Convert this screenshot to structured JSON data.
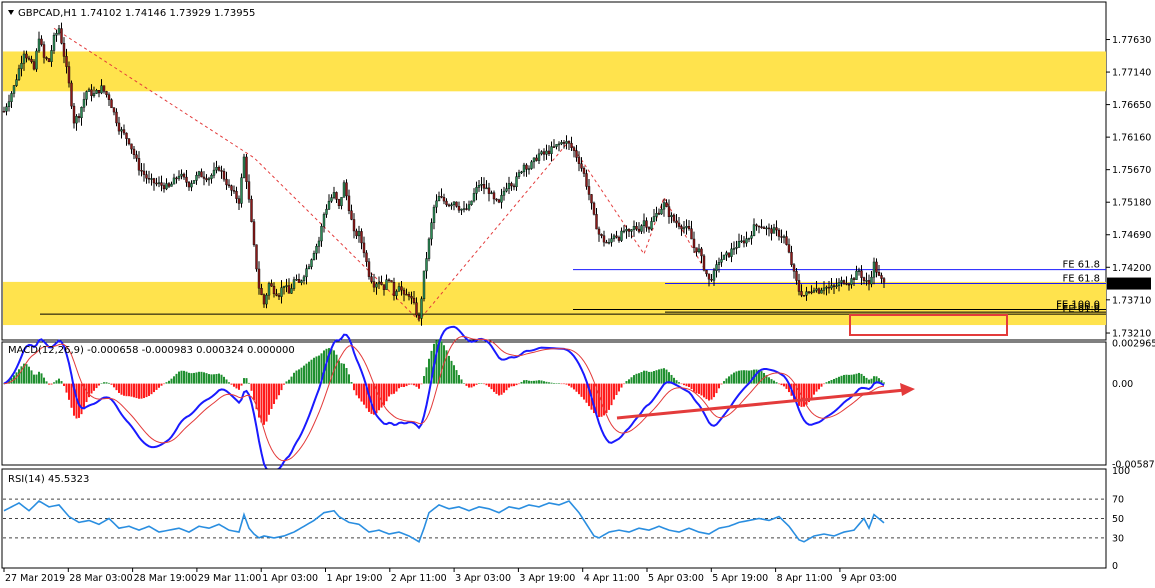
{
  "chart_data": {
    "type": "candlestick",
    "symbol_header": "GBPCAD,H1  1.74102 1.74146 1.73929 1.73955",
    "y_ticks": [
      "1.77630",
      "1.77140",
      "1.76650",
      "1.76160",
      "1.75670",
      "1.75180",
      "1.74690",
      "1.74200",
      "1.73710",
      "1.73210"
    ],
    "y_range": [
      1.7312,
      1.7818
    ],
    "current_price": "1.73955",
    "x_ticks": [
      "27 Mar 2019",
      "28 Mar 03:00",
      "28 Mar 19:00",
      "29 Mar 11:00",
      "1 Apr 03:00",
      "1 Apr 19:00",
      "2 Apr 11:00",
      "3 Apr 03:00",
      "3 Apr 19:00",
      "4 Apr 11:00",
      "5 Apr 03:00",
      "5 Apr 19:00",
      "8 Apr 11:00",
      "9 Apr 03:00"
    ],
    "price_path": [
      [
        0,
        1.7655
      ],
      [
        4,
        1.7692
      ],
      [
        8,
        1.7745
      ],
      [
        12,
        1.7718
      ],
      [
        14,
        1.7768
      ],
      [
        16,
        1.7735
      ],
      [
        18,
        1.773
      ],
      [
        20,
        1.7765
      ],
      [
        22,
        1.778
      ],
      [
        24,
        1.774
      ],
      [
        26,
        1.7695
      ],
      [
        28,
        1.764
      ],
      [
        30,
        1.765
      ],
      [
        33,
        1.7685
      ],
      [
        36,
        1.768
      ],
      [
        39,
        1.769
      ],
      [
        42,
        1.7675
      ],
      [
        46,
        1.763
      ],
      [
        50,
        1.761
      ],
      [
        54,
        1.757
      ],
      [
        58,
        1.755
      ],
      [
        62,
        1.7545
      ],
      [
        66,
        1.754
      ],
      [
        70,
        1.756
      ],
      [
        74,
        1.7545
      ],
      [
        78,
        1.756
      ],
      [
        82,
        1.7555
      ],
      [
        86,
        1.757
      ],
      [
        90,
        1.754
      ],
      [
        94,
        1.752
      ],
      [
        96,
        1.7585
      ],
      [
        98,
        1.752
      ],
      [
        100,
        1.745
      ],
      [
        102,
        1.739
      ],
      [
        104,
        1.7365
      ],
      [
        106,
        1.7395
      ],
      [
        108,
        1.7385
      ],
      [
        110,
        1.738
      ],
      [
        112,
        1.7395
      ],
      [
        114,
        1.738
      ],
      [
        116,
        1.74
      ],
      [
        118,
        1.7395
      ],
      [
        120,
        1.741
      ],
      [
        122,
        1.7425
      ],
      [
        124,
        1.7445
      ],
      [
        126,
        1.746
      ],
      [
        128,
        1.75
      ],
      [
        130,
        1.752
      ],
      [
        132,
        1.753
      ],
      [
        134,
        1.751
      ],
      [
        136,
        1.7545
      ],
      [
        138,
        1.751
      ],
      [
        140,
        1.747
      ],
      [
        142,
        1.747
      ],
      [
        144,
        1.7445
      ],
      [
        146,
        1.741
      ],
      [
        148,
        1.7395
      ],
      [
        150,
        1.74
      ],
      [
        152,
        1.739
      ],
      [
        154,
        1.7405
      ],
      [
        156,
        1.738
      ],
      [
        158,
        1.7395
      ],
      [
        160,
        1.7375
      ],
      [
        162,
        1.738
      ],
      [
        164,
        1.7362
      ],
      [
        166,
        1.734
      ],
      [
        168,
        1.741
      ],
      [
        170,
        1.746
      ],
      [
        172,
        1.751
      ],
      [
        174,
        1.7525
      ],
      [
        176,
        1.752
      ],
      [
        178,
        1.7515
      ],
      [
        180,
        1.752
      ],
      [
        182,
        1.751
      ],
      [
        184,
        1.7505
      ],
      [
        186,
        1.751
      ],
      [
        188,
        1.753
      ],
      [
        190,
        1.7545
      ],
      [
        192,
        1.754
      ],
      [
        194,
        1.7535
      ],
      [
        196,
        1.752
      ],
      [
        198,
        1.7515
      ],
      [
        200,
        1.7535
      ],
      [
        202,
        1.755
      ],
      [
        204,
        1.7545
      ],
      [
        206,
        1.756
      ],
      [
        208,
        1.7575
      ],
      [
        210,
        1.757
      ],
      [
        212,
        1.758
      ],
      [
        214,
        1.759
      ],
      [
        216,
        1.759
      ],
      [
        218,
        1.7595
      ],
      [
        220,
        1.76
      ],
      [
        222,
        1.7605
      ],
      [
        224,
        1.761
      ],
      [
        226,
        1.7605
      ],
      [
        228,
        1.7595
      ],
      [
        230,
        1.758
      ],
      [
        232,
        1.756
      ],
      [
        234,
        1.753
      ],
      [
        236,
        1.7495
      ],
      [
        238,
        1.747
      ],
      [
        240,
        1.746
      ],
      [
        242,
        1.7455
      ],
      [
        244,
        1.747
      ],
      [
        246,
        1.7465
      ],
      [
        248,
        1.7475
      ],
      [
        250,
        1.747
      ],
      [
        252,
        1.748
      ],
      [
        254,
        1.7478
      ],
      [
        256,
        1.749
      ],
      [
        258,
        1.748
      ],
      [
        260,
        1.7495
      ],
      [
        262,
        1.7505
      ],
      [
        264,
        1.7515
      ],
      [
        266,
        1.75
      ],
      [
        268,
        1.749
      ],
      [
        270,
        1.7485
      ],
      [
        272,
        1.748
      ],
      [
        274,
        1.7475
      ],
      [
        276,
        1.745
      ],
      [
        278,
        1.7445
      ],
      [
        280,
        1.742
      ],
      [
        282,
        1.74
      ],
      [
        284,
        1.741
      ],
      [
        286,
        1.743
      ],
      [
        288,
        1.7435
      ],
      [
        290,
        1.744
      ],
      [
        292,
        1.745
      ],
      [
        294,
        1.7455
      ],
      [
        296,
        1.746
      ],
      [
        298,
        1.7465
      ],
      [
        300,
        1.748
      ],
      [
        302,
        1.7485
      ],
      [
        304,
        1.748
      ],
      [
        306,
        1.7475
      ],
      [
        308,
        1.7475
      ],
      [
        310,
        1.747
      ],
      [
        312,
        1.7465
      ],
      [
        314,
        1.744
      ],
      [
        316,
        1.741
      ],
      [
        318,
        1.7385
      ],
      [
        320,
        1.7378
      ],
      [
        322,
        1.7382
      ],
      [
        324,
        1.739
      ],
      [
        326,
        1.7385
      ],
      [
        328,
        1.7392
      ],
      [
        330,
        1.7388
      ],
      [
        332,
        1.739
      ],
      [
        334,
        1.7395
      ],
      [
        336,
        1.74
      ],
      [
        338,
        1.7398
      ],
      [
        340,
        1.7405
      ],
      [
        342,
        1.7415
      ],
      [
        344,
        1.74
      ],
      [
        346,
        1.7395
      ],
      [
        348,
        1.7425
      ],
      [
        350,
        1.7405
      ],
      [
        352,
        1.7395
      ]
    ],
    "fe_levels": [
      {
        "label": "FE 61.8",
        "price": 1.74165,
        "color": "#1a1aff"
      },
      {
        "label": "FE 61.8",
        "price": 1.73955,
        "color": "#1a1aff"
      },
      {
        "label": "FE 100.0",
        "price": 1.73565,
        "color": "#000000"
      },
      {
        "label": "FE 100.0",
        "price": 1.73525,
        "color": "#000000"
      },
      {
        "label": "FE 61.8",
        "price": 1.73495,
        "color": "#000000"
      }
    ],
    "zones": [
      {
        "from": 1.7685,
        "to": 1.7745,
        "color": "#ffe34d"
      },
      {
        "from": 1.7333,
        "to": 1.7398,
        "color": "#ffe34d"
      }
    ],
    "macd": {
      "label": "MACD(12,26,9) -0.000658 -0.000983 0.000324 0.000000",
      "y_ticks": [
        "0.002965",
        "0.00",
        "-0.005873"
      ],
      "y_range": [
        -0.005873,
        0.002965
      ]
    },
    "rsi": {
      "label": "RSI(14) 45.5323",
      "y_ticks": [
        "100",
        "70",
        "50",
        "30",
        "0"
      ],
      "levels": [
        70,
        50,
        30
      ],
      "path": [
        [
          0,
          58
        ],
        [
          6,
          66
        ],
        [
          10,
          58
        ],
        [
          14,
          68
        ],
        [
          18,
          62
        ],
        [
          22,
          64
        ],
        [
          26,
          52
        ],
        [
          30,
          46
        ],
        [
          34,
          48
        ],
        [
          38,
          44
        ],
        [
          42,
          50
        ],
        [
          46,
          40
        ],
        [
          50,
          42
        ],
        [
          54,
          38
        ],
        [
          58,
          42
        ],
        [
          62,
          36
        ],
        [
          66,
          38
        ],
        [
          70,
          40
        ],
        [
          74,
          36
        ],
        [
          78,
          42
        ],
        [
          82,
          40
        ],
        [
          86,
          44
        ],
        [
          90,
          38
        ],
        [
          94,
          36
        ],
        [
          96,
          54
        ],
        [
          98,
          40
        ],
        [
          100,
          34
        ],
        [
          102,
          30
        ],
        [
          104,
          32
        ],
        [
          108,
          30
        ],
        [
          112,
          32
        ],
        [
          116,
          36
        ],
        [
          120,
          42
        ],
        [
          124,
          48
        ],
        [
          128,
          56
        ],
        [
          132,
          58
        ],
        [
          134,
          52
        ],
        [
          138,
          46
        ],
        [
          142,
          44
        ],
        [
          146,
          36
        ],
        [
          150,
          38
        ],
        [
          154,
          34
        ],
        [
          158,
          36
        ],
        [
          162,
          32
        ],
        [
          166,
          26
        ],
        [
          168,
          40
        ],
        [
          170,
          56
        ],
        [
          174,
          64
        ],
        [
          178,
          60
        ],
        [
          182,
          62
        ],
        [
          186,
          58
        ],
        [
          190,
          62
        ],
        [
          194,
          60
        ],
        [
          198,
          56
        ],
        [
          202,
          62
        ],
        [
          206,
          60
        ],
        [
          210,
          64
        ],
        [
          214,
          62
        ],
        [
          218,
          66
        ],
        [
          222,
          64
        ],
        [
          226,
          68
        ],
        [
          228,
          62
        ],
        [
          230,
          56
        ],
        [
          232,
          48
        ],
        [
          234,
          40
        ],
        [
          236,
          32
        ],
        [
          238,
          30
        ],
        [
          242,
          36
        ],
        [
          246,
          38
        ],
        [
          250,
          36
        ],
        [
          254,
          40
        ],
        [
          258,
          38
        ],
        [
          262,
          42
        ],
        [
          266,
          38
        ],
        [
          270,
          36
        ],
        [
          274,
          40
        ],
        [
          278,
          36
        ],
        [
          282,
          34
        ],
        [
          286,
          40
        ],
        [
          290,
          42
        ],
        [
          294,
          46
        ],
        [
          298,
          48
        ],
        [
          302,
          50
        ],
        [
          306,
          48
        ],
        [
          310,
          52
        ],
        [
          314,
          42
        ],
        [
          318,
          28
        ],
        [
          320,
          26
        ],
        [
          324,
          32
        ],
        [
          328,
          34
        ],
        [
          332,
          32
        ],
        [
          336,
          36
        ],
        [
          340,
          38
        ],
        [
          344,
          50
        ],
        [
          346,
          40
        ],
        [
          348,
          54
        ],
        [
          352,
          45.5
        ]
      ]
    },
    "arrow_color": "#e33b3b"
  }
}
